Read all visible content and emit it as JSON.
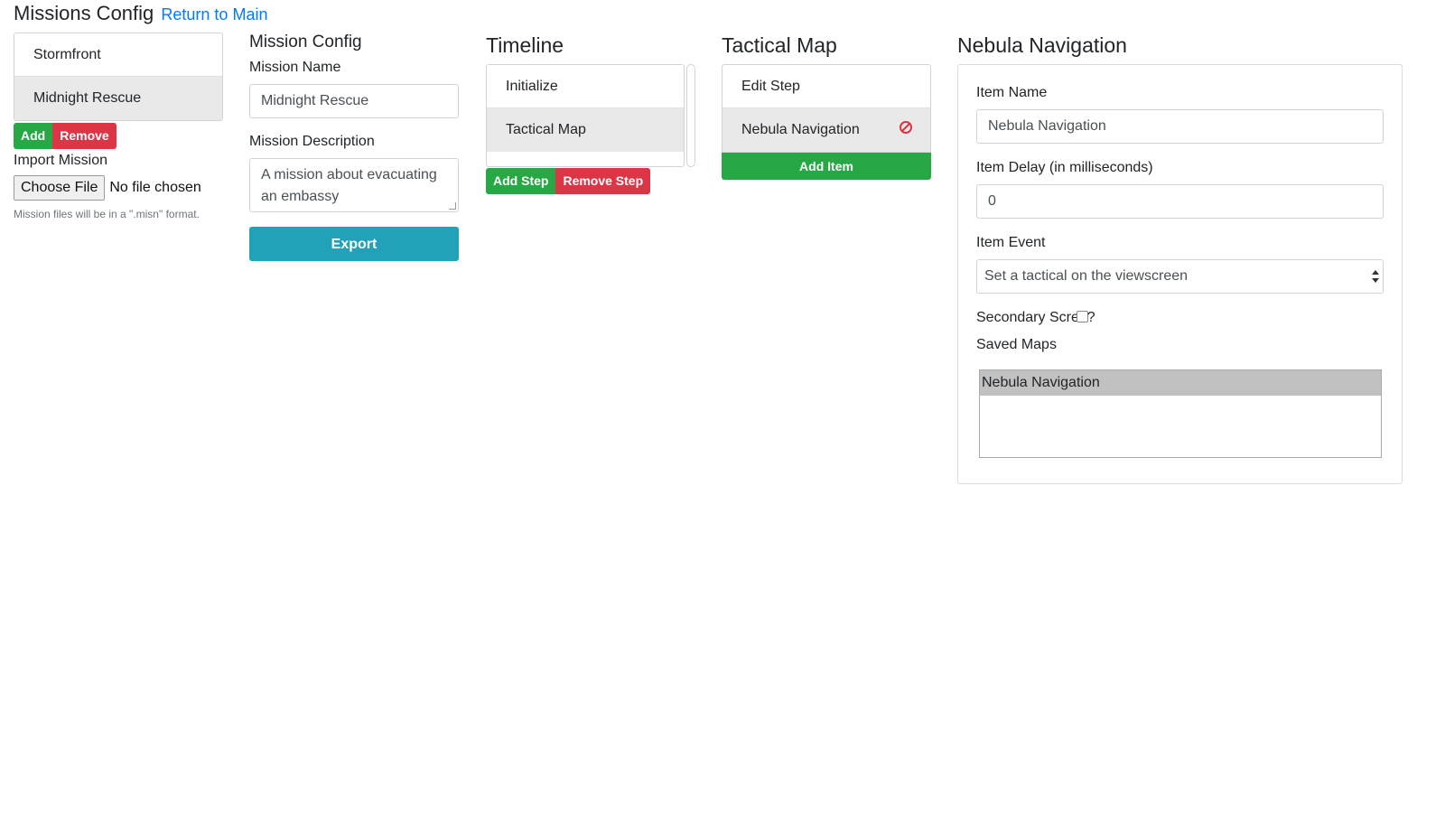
{
  "header": {
    "title": "Missions Config",
    "return_link": "Return to Main"
  },
  "missions": {
    "items": [
      {
        "label": "Stormfront"
      },
      {
        "label": "Midnight Rescue"
      }
    ],
    "add_label": "Add",
    "remove_label": "Remove",
    "import_label": "Import Mission",
    "file_button": "Choose File",
    "file_status": "No file chosen",
    "hint": "Mission files will be in a \".misn\" format."
  },
  "mission_config": {
    "heading": "Mission Config",
    "name_label": "Mission Name",
    "name_value": "Midnight Rescue",
    "description_label": "Mission Description",
    "description_value": "A mission about evacuating an embassy",
    "export_label": "Export"
  },
  "timeline": {
    "heading": "Timeline",
    "items": [
      {
        "label": "Initialize"
      },
      {
        "label": "Tactical Map"
      }
    ],
    "add_step_label": "Add Step",
    "remove_step_label": "Remove Step"
  },
  "tactical_map": {
    "heading": "Tactical Map",
    "items": [
      {
        "label": "Edit Step"
      },
      {
        "label": "Nebula Navigation"
      }
    ],
    "add_item_label": "Add Item",
    "remove_icon": "block-icon"
  },
  "nebula": {
    "heading": "Nebula Navigation",
    "item_name_label": "Item Name",
    "item_name_value": "Nebula Navigation",
    "item_delay_label": "Item Delay (in milliseconds)",
    "item_delay_value": "0",
    "item_event_label": "Item Event",
    "item_event_value": "Set a tactical on the viewscreen",
    "secondary_screen_label_start": "Secondary Scree",
    "secondary_screen_label_end": "?",
    "saved_maps_label": "Saved Maps",
    "saved_maps": [
      "Nebula Navigation"
    ]
  },
  "colors": {
    "success": "#28a745",
    "danger": "#dc3545",
    "info": "#22a2b8",
    "link": "#007bff"
  }
}
